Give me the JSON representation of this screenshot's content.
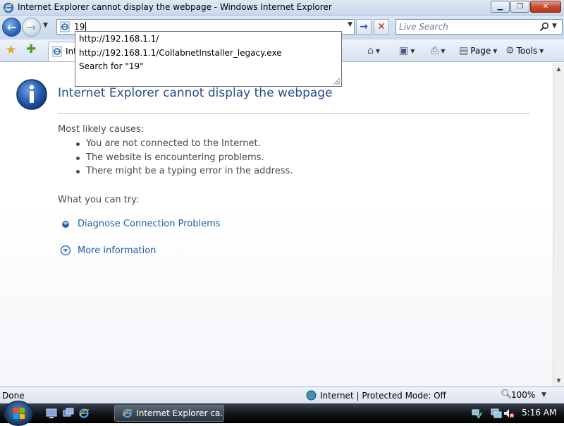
{
  "window": {
    "title": "Internet Explorer cannot display the webpage - Windows Internet Explorer",
    "buttons": {
      "minimize": "▁",
      "maximize": "❐",
      "close": "✕"
    }
  },
  "navbar": {
    "address_value": "19",
    "search_placeholder": "Live Search",
    "go_icon": "→",
    "stop_icon": "✕"
  },
  "autocomplete": {
    "items": [
      "http://192.168.1.1/",
      "http://192.168.1.1/CollabnetInstaller_legacy.exe",
      "Search for \"19\""
    ]
  },
  "cmdbar": {
    "tab_label": "Int",
    "page_label": "Page",
    "tools_label": "Tools"
  },
  "content": {
    "title": "Internet Explorer cannot display the webpage",
    "causes_title": "Most likely causes:",
    "causes": [
      "You are not connected to the Internet.",
      "The website is encountering problems.",
      "There might be a typing error in the address."
    ],
    "try_title": "What you can try:",
    "diagnose_link": "Diagnose Connection Problems",
    "more_info_link": "More information"
  },
  "statusbar": {
    "status": "Done",
    "zone": "Internet | Protected Mode: Off",
    "zoom": "100%"
  },
  "taskbar": {
    "task_label": "Internet Explorer ca...",
    "clock": "5:16 AM"
  },
  "colors": {
    "title_blue": "#1f4f8f",
    "link_blue": "#1f5fa6",
    "text_gray": "#4a4a4a"
  }
}
